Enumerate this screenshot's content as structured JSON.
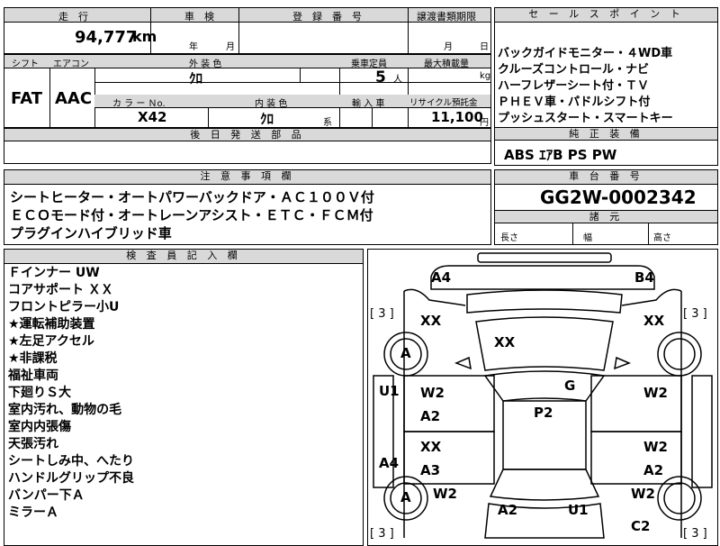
{
  "top_row": {
    "mileage_label": "走　行",
    "mileage_value": "94,777",
    "mileage_unit": "km",
    "inspection_label": "車　検",
    "inspection_year": "年",
    "inspection_month": "月",
    "registration_label": "登　録　番　号",
    "transfer_label": "譲渡書類期限",
    "transfer_month": "月",
    "transfer_day": "日"
  },
  "mid_row": {
    "shift_label": "シフト",
    "shift_value": "FAT",
    "aircon_label": "エアコン",
    "aircon_value": "AAC",
    "exterior_label": "外 装 色",
    "exterior_value": "ｸﾛ",
    "capacity_label": "乗車定員",
    "capacity_value": "5",
    "capacity_unit": "人",
    "max_load_label": "最大積載量",
    "max_load_unit": "kg",
    "color_no_label": "カ ラ ー Ｎo.",
    "color_no_value": "X42",
    "interior_label": "内 装 色",
    "interior_value": "ｸﾛ",
    "interior_unit": "系",
    "import_label": "輸 入 車",
    "recycle_label": "リサイクル預託金",
    "recycle_value": "11,100",
    "recycle_unit": "円"
  },
  "later_parts_label": "後 日 発 送 部 品",
  "sales_points": {
    "header": "セ ー ル ス ポ イ ン ト",
    "lines": [
      "バックガイドモニター・４WD車",
      "クルーズコントロール・ナビ",
      "ハーフレザーシート付・ＴＶ",
      "ＰＨＥＶ車・パドルシフト付",
      "プッシュスタート・スマートキー"
    ]
  },
  "genuine_equipment": {
    "header": "純 正 装 備",
    "value": "ABS ｴｱB PS PW"
  },
  "caution": {
    "header": "注 意 事 項 欄",
    "lines": [
      "シートヒーター・オートパワーバックドア・ＡＣ１００Ｖ付",
      "ＥＣＯモード付・オートレーンアシスト・ＥＴＣ・ＦＣＭ付",
      "プラグインハイブリッド車"
    ]
  },
  "chassis": {
    "header": "車 台 番 号",
    "value": "GG2W-0002342",
    "dimensions_header": "諸 元",
    "length": "長さ",
    "width": "幅",
    "height": "高さ"
  },
  "inspector": {
    "header": "検 査 員 記 入 欄",
    "lines": [
      "Ｆインナー UW",
      "コアサポート ＸＸ",
      "フロントピラー小U",
      "★運転補助装置",
      "★左足アクセル",
      "★非課税",
      "福祉車両",
      "下廻りＳ大",
      "室内汚れ、動物の毛",
      "室内内張傷",
      "天張汚れ",
      "シートしみ中、へたり",
      "ハンドルグリップ不良",
      "バンパー下Ａ",
      "ミラーＡ"
    ]
  },
  "diagram": {
    "tyre_rating": "[ 3 ]",
    "marks": {
      "front_left_corner": "A4",
      "front_right_corner": "B4",
      "left_front_fender": "XX",
      "right_front_fender": "XX",
      "hood": "XX",
      "left_front_tyre": "A",
      "left_pillar": "U1",
      "left_door_front_top": "W2",
      "left_door_front_bottom": "A2",
      "glass": "G",
      "roof": "P2",
      "right_door_front": "W2",
      "left_door_rear_top": "XX",
      "left_door_rear_bottom": "A3",
      "left_rocker": "A4",
      "right_door_rear_top": "W2",
      "right_door_rear_bottom": "A2",
      "left_rear_tyre": "A",
      "left_rear_fender": "W2",
      "right_rear_fender": "W2",
      "trunk": "A2",
      "rear_center": "U1",
      "rear_right": "C2"
    }
  }
}
